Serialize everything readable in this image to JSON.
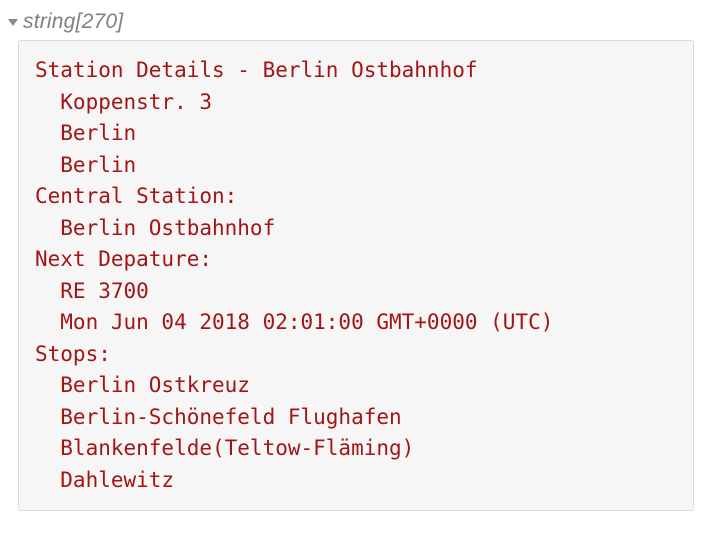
{
  "header": {
    "type_word": "string",
    "length_label": "[270]"
  },
  "content": "Station Details - Berlin Ostbahnhof\n  Koppenstr. 3\n  Berlin\n  Berlin\nCentral Station:\n  Berlin Ostbahnhof\nNext Depature:\n  RE 3700\n  Mon Jun 04 2018 02:01:00 GMT+0000 (UTC)\nStops:\n  Berlin Ostkreuz\n  Berlin-Schönefeld Flughafen\n  Blankenfelde(Teltow-Fläming)\n  Dahlewitz"
}
